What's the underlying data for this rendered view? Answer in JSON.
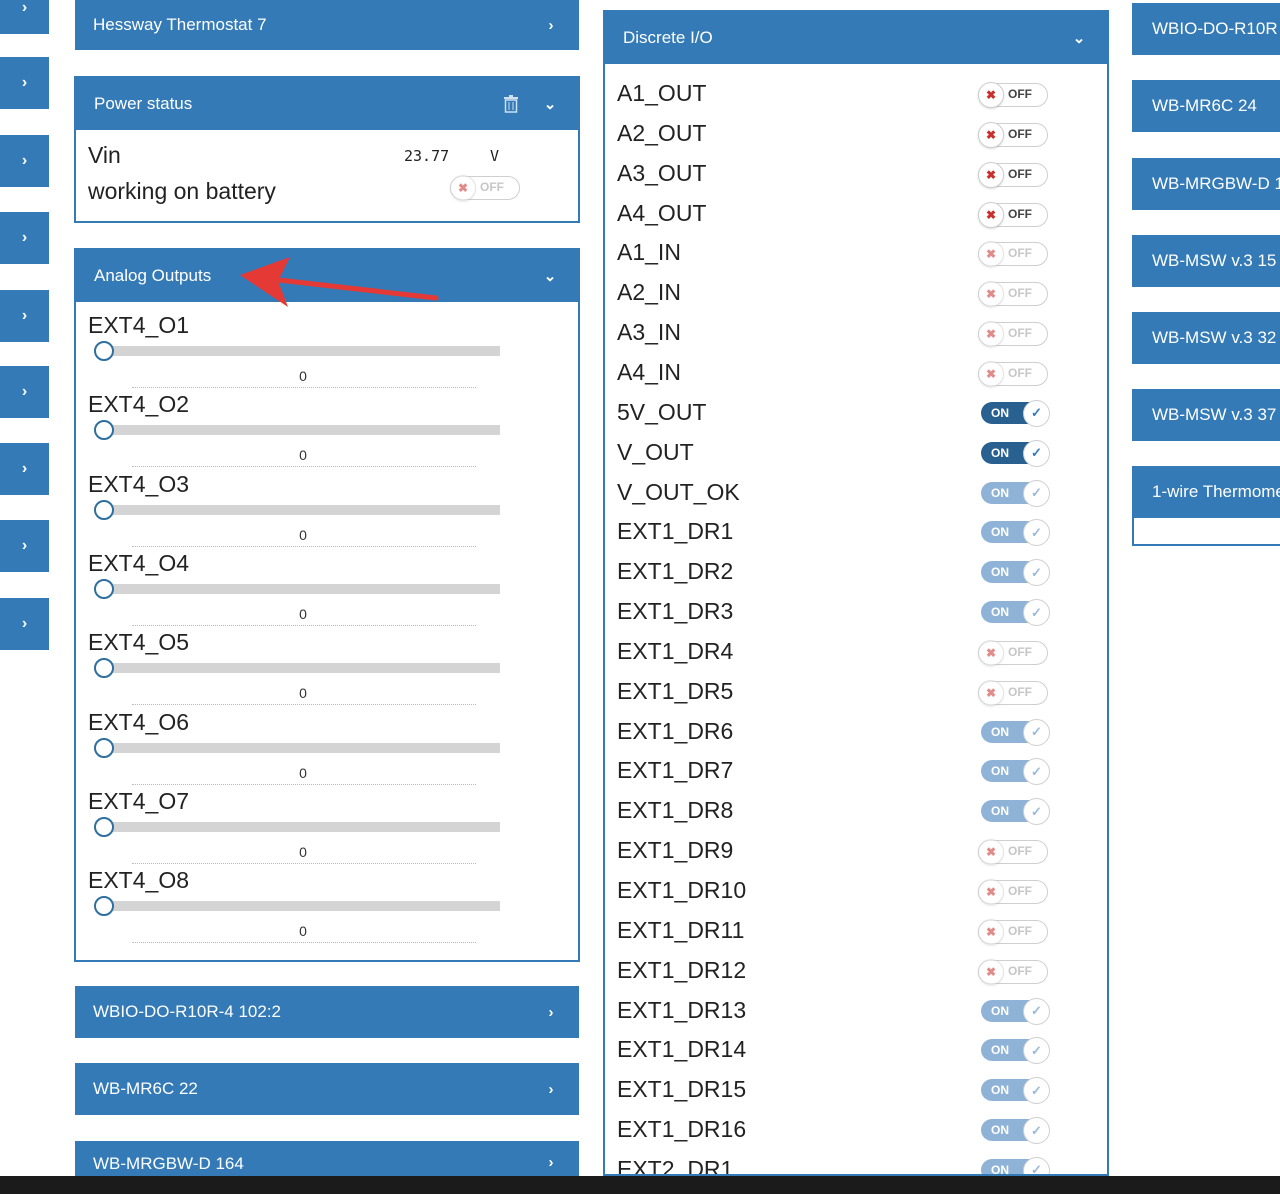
{
  "left_strip": {
    "count": 9,
    "chevron": "›"
  },
  "left_column": {
    "top_panel": {
      "title": "Hessway Thermostat 7",
      "chevron": "›"
    },
    "power_status": {
      "title": "Power status",
      "icons": [
        "trash-icon",
        "chevron-down-icon"
      ],
      "vin_label": "Vin",
      "vin_value": "23.77",
      "vin_unit": "V",
      "battery_label": "working on battery",
      "battery_state": "OFF"
    },
    "analog_outputs": {
      "title": "Analog Outputs",
      "chevron": "⌄",
      "items": [
        {
          "label": "EXT4_O1",
          "value": "0"
        },
        {
          "label": "EXT4_O2",
          "value": "0"
        },
        {
          "label": "EXT4_O3",
          "value": "0"
        },
        {
          "label": "EXT4_O4",
          "value": "0"
        },
        {
          "label": "EXT4_O5",
          "value": "0"
        },
        {
          "label": "EXT4_O6",
          "value": "0"
        },
        {
          "label": "EXT4_O7",
          "value": "0"
        },
        {
          "label": "EXT4_O8",
          "value": "0"
        }
      ]
    },
    "collapsed_panels": [
      {
        "title": "WBIO-DO-R10R-4 102:2"
      },
      {
        "title": "WB-MR6C 22"
      },
      {
        "title": "WB-MRGBW-D 164"
      }
    ]
  },
  "discrete_io": {
    "title": "Discrete I/O",
    "rows": [
      {
        "label": "A1_OUT",
        "state": "OFF",
        "style": "strong"
      },
      {
        "label": "A2_OUT",
        "state": "OFF",
        "style": "strong"
      },
      {
        "label": "A3_OUT",
        "state": "OFF",
        "style": "strong"
      },
      {
        "label": "A4_OUT",
        "state": "OFF",
        "style": "strong"
      },
      {
        "label": "A1_IN",
        "state": "OFF",
        "style": "dim"
      },
      {
        "label": "A2_IN",
        "state": "OFF",
        "style": "dim"
      },
      {
        "label": "A3_IN",
        "state": "OFF",
        "style": "dim"
      },
      {
        "label": "A4_IN",
        "state": "OFF",
        "style": "dim"
      },
      {
        "label": "5V_OUT",
        "state": "ON",
        "style": "strong"
      },
      {
        "label": "V_OUT",
        "state": "ON",
        "style": "strong"
      },
      {
        "label": "V_OUT_OK",
        "state": "ON",
        "style": "dim"
      },
      {
        "label": "EXT1_DR1",
        "state": "ON",
        "style": "dim"
      },
      {
        "label": "EXT1_DR2",
        "state": "ON",
        "style": "dim"
      },
      {
        "label": "EXT1_DR3",
        "state": "ON",
        "style": "dim"
      },
      {
        "label": "EXT1_DR4",
        "state": "OFF",
        "style": "dim"
      },
      {
        "label": "EXT1_DR5",
        "state": "OFF",
        "style": "dim"
      },
      {
        "label": "EXT1_DR6",
        "state": "ON",
        "style": "dim"
      },
      {
        "label": "EXT1_DR7",
        "state": "ON",
        "style": "dim"
      },
      {
        "label": "EXT1_DR8",
        "state": "ON",
        "style": "dim"
      },
      {
        "label": "EXT1_DR9",
        "state": "OFF",
        "style": "dim"
      },
      {
        "label": "EXT1_DR10",
        "state": "OFF",
        "style": "dim"
      },
      {
        "label": "EXT1_DR11",
        "state": "OFF",
        "style": "dim"
      },
      {
        "label": "EXT1_DR12",
        "state": "OFF",
        "style": "dim"
      },
      {
        "label": "EXT1_DR13",
        "state": "ON",
        "style": "dim"
      },
      {
        "label": "EXT1_DR14",
        "state": "ON",
        "style": "dim"
      },
      {
        "label": "EXT1_DR15",
        "state": "ON",
        "style": "dim"
      },
      {
        "label": "EXT1_DR16",
        "state": "ON",
        "style": "dim"
      },
      {
        "label": "EXT2_DR1",
        "state": "ON",
        "style": "dim"
      }
    ]
  },
  "right_column": [
    {
      "title": "WBIO-DO-R10R"
    },
    {
      "title": "WB-MR6C 24"
    },
    {
      "title": "WB-MRGBW-D 1"
    },
    {
      "title": "WB-MSW v.3 15"
    },
    {
      "title": "WB-MSW v.3 32"
    },
    {
      "title": "WB-MSW v.3 37"
    },
    {
      "title": "1-wire Thermome"
    }
  ],
  "colors": {
    "primary": "#337ab7",
    "toggle_on": "#286090",
    "annotation_arrow": "#e53935"
  }
}
